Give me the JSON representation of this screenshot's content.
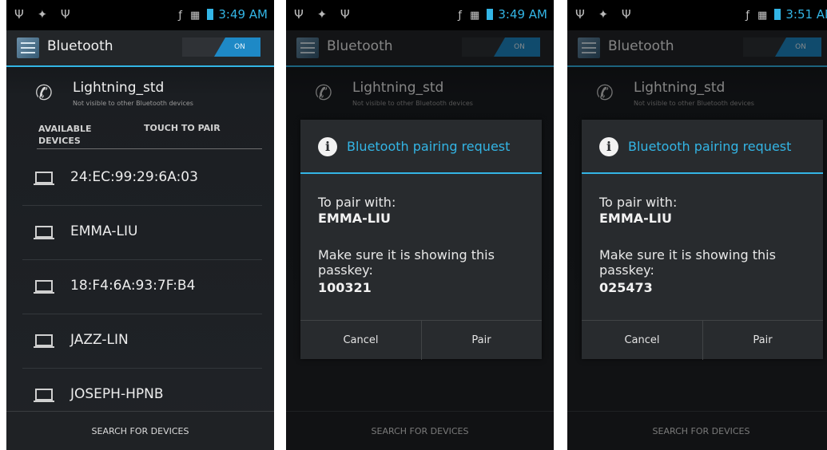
{
  "status_bar": {
    "left_icons": "Ψ ✦ Ψ",
    "right_icons": "ƒ ▦",
    "times": [
      "3:49 AM",
      "3:49 AM",
      "3:51 AM"
    ]
  },
  "action_bar": {
    "icon": "bluetooth-settings-icon",
    "title": "Bluetooth",
    "toggle_label": "ON"
  },
  "own_device": {
    "icon": "phone-icon",
    "name": "Lightning_std",
    "subtitle": "Not visible to other Bluetooth devices"
  },
  "available_header": {
    "line1": "AVAILABLE",
    "line2": "DEVICES",
    "action": "TOUCH TO PAIR"
  },
  "devices": [
    {
      "name": "24:EC:99:29:6A:03",
      "icon": "laptop-icon"
    },
    {
      "name": "EMMA-LIU",
      "icon": "laptop-icon"
    },
    {
      "name": "18:F4:6A:93:7F:B4",
      "icon": "laptop-icon"
    },
    {
      "name": "JAZZ-LIN",
      "icon": "laptop-icon"
    },
    {
      "name": "JOSEPH-HPNB",
      "icon": "laptop-icon"
    }
  ],
  "bottom_button": "SEARCH FOR DEVICES",
  "dialogs": [
    {
      "title": "Bluetooth pairing request",
      "label": "To pair with:",
      "device": "EMMA-LIU",
      "message": "Make sure it is showing this passkey:",
      "passkey": "100321",
      "cancel": "Cancel",
      "pair": "Pair"
    },
    {
      "title": "Bluetooth pairing request",
      "label": "To pair with:",
      "device": "EMMA-LIU",
      "message": "Make sure it is showing this passkey:",
      "passkey": "025473",
      "cancel": "Cancel",
      "pair": "Pair"
    }
  ],
  "colors": {
    "accent": "#33b5e5",
    "toggle_on": "#1e89c6",
    "background": "#1b1e22"
  }
}
